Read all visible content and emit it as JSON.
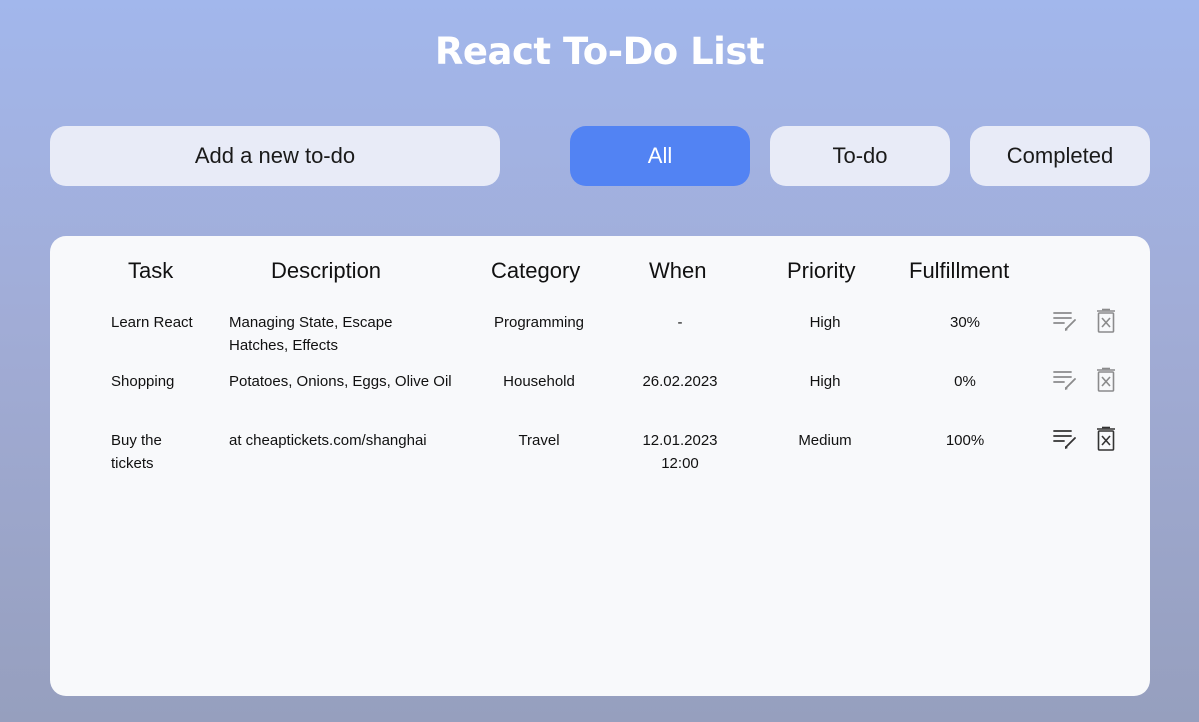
{
  "app": {
    "title": "React To-Do List"
  },
  "toolbar": {
    "add_label": "Add a new to-do",
    "filters": [
      {
        "label": "All",
        "active": true
      },
      {
        "label": "To-do",
        "active": false
      },
      {
        "label": "Completed",
        "active": false
      }
    ]
  },
  "table": {
    "columns": [
      "Task",
      "Description",
      "Category",
      "When",
      "Priority",
      "Fulfillment"
    ],
    "rows": [
      {
        "task": "Learn React",
        "description": "Managing State, Escape Hatches, Effects",
        "category": "Programming",
        "when": "-",
        "priority": "High",
        "fulfillment": "30%"
      },
      {
        "task": "Shopping",
        "description": "Potatoes, Onions, Eggs, Olive Oil",
        "category": "Household",
        "when": "26.02.2023",
        "priority": "High",
        "fulfillment": "0%"
      },
      {
        "task": "Buy the tickets",
        "description": "at cheaptickets.com/shanghai",
        "category": "Travel",
        "when": "12.01.2023 12:00",
        "priority": "Medium",
        "fulfillment": "100%"
      }
    ],
    "row_icons": [
      "edit-icon",
      "delete-icon"
    ]
  },
  "colors": {
    "active_filter": "#5283f3",
    "button_bg": "#e8ebf7",
    "panel_bg": "#f8f9fb",
    "title": "#ffffff"
  }
}
